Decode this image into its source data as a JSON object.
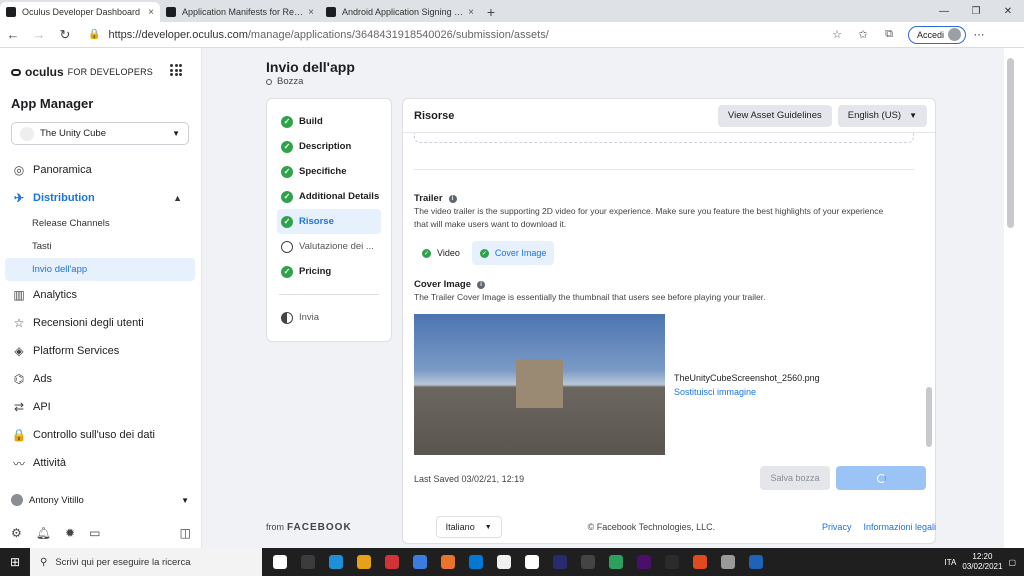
{
  "browser": {
    "tabs": [
      {
        "title": "Oculus Developer Dashboard",
        "close": "×"
      },
      {
        "title": "Application Manifests for Release",
        "close": "×"
      },
      {
        "title": "Android Application Signing | O",
        "close": "×"
      }
    ],
    "new_tab": "+",
    "window": {
      "minimize": "—",
      "maximize": "❐",
      "close": "✕"
    },
    "back": "←",
    "forward": "→",
    "reload": "↻",
    "url_prefix": "https://developer.oculus.com",
    "url_path": "/manage/applications/3648431918540026/submission/assets/",
    "signin_label": "Accedi",
    "more": "⋯"
  },
  "sidebar": {
    "brand": "oculus",
    "brand_suffix": "FOR DEVELOPERS",
    "section_title": "App Manager",
    "app_selector": "The Unity Cube",
    "nav": [
      {
        "label": "Panoramica",
        "icon": "◎"
      },
      {
        "label": "Distribution",
        "icon": "✈"
      },
      {
        "label": "Analytics",
        "icon": "▥"
      },
      {
        "label": "Recensioni degli utenti",
        "icon": "☆"
      },
      {
        "label": "Platform Services",
        "icon": "◈"
      },
      {
        "label": "Ads",
        "icon": "⌬"
      },
      {
        "label": "API",
        "icon": "⇄"
      },
      {
        "label": "Controllo sull'uso dei dati",
        "icon": "🔒"
      },
      {
        "label": "Attività",
        "icon": "〰"
      }
    ],
    "sub_items": [
      "Release Channels",
      "Tasti",
      "Invio dell'app"
    ],
    "user": "Antony Vitillo"
  },
  "page": {
    "title": "Invio dell'app",
    "status": "Bozza",
    "steps": [
      {
        "label": "Build",
        "state": "done"
      },
      {
        "label": "Description",
        "state": "done"
      },
      {
        "label": "Specifiche",
        "state": "done"
      },
      {
        "label": "Additional Details",
        "state": "done"
      },
      {
        "label": "Risorse",
        "state": "done"
      },
      {
        "label": "Valutazione dei ...",
        "state": "pending"
      },
      {
        "label": "Pricing",
        "state": "done"
      },
      {
        "label": "Invia",
        "state": "half"
      }
    ]
  },
  "card": {
    "title": "Risorse",
    "guidelines_button": "View Asset Guidelines",
    "language": "English (US)",
    "trailer_title": "Trailer",
    "trailer_desc": "The video trailer is the supporting 2D video for your experience. Make sure you feature the best highlights of your experience that will make users want to download it.",
    "chips": [
      "Video",
      "Cover Image"
    ],
    "cover_title": "Cover Image",
    "cover_desc": "The Trailer Cover Image is essentially the thumbnail that users see before playing your trailer.",
    "file_name": "TheUnityCubeScreenshot_2560.png",
    "replace_link": "Sostituisci immagine",
    "last_saved": "Last Saved 03/02/21, 12:19",
    "save_draft": "Salva bozza"
  },
  "footer": {
    "from": "from",
    "facebook": "FACEBOOK",
    "language": "Italiano",
    "copyright": "© Facebook Technologies, LLC.",
    "privacy": "Privacy",
    "legal": "Informazioni legali"
  },
  "taskbar": {
    "search_placeholder": "Scrivi qui per eseguire la ricerca",
    "lang": "ITA",
    "time": "12:20",
    "date": "03/02/2021",
    "app_colors": [
      "#ffffff",
      "#3c3c3c",
      "#1e90d6",
      "#e6a117",
      "#d13438",
      "#3b7ddd",
      "#e9722c",
      "#0078d4",
      "#f0f0f0",
      "#ffffff",
      "#2a2a6e",
      "#444444",
      "#2d9f5e",
      "#4b0f6b",
      "#2b2b2b",
      "#e04a1f",
      "#9a9a9a",
      "#1e63b5"
    ]
  }
}
